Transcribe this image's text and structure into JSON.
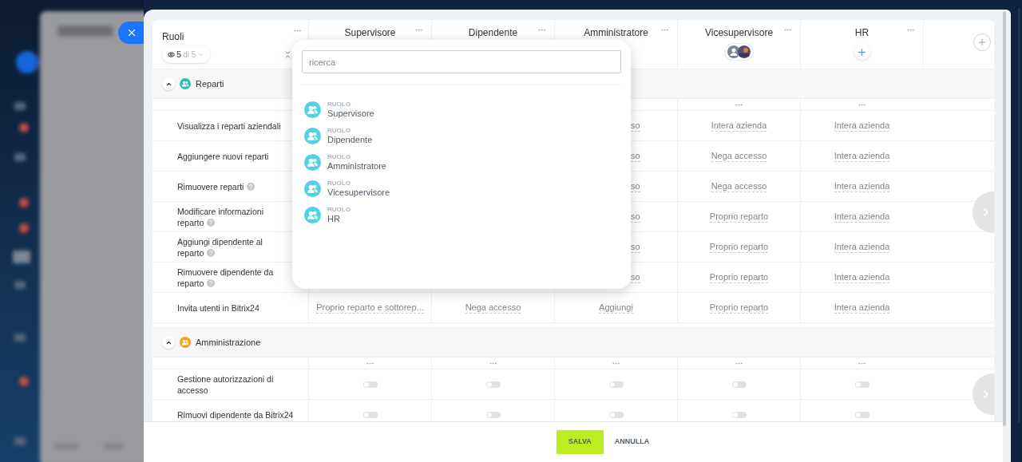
{
  "table": {
    "title": "Ruoli",
    "filter": {
      "shown": "5",
      "total": "di 5"
    },
    "columns": [
      {
        "name": "Supervisore",
        "kind": "none"
      },
      {
        "name": "Dipendente",
        "kind": "none"
      },
      {
        "name": "Amministratore",
        "kind": "none"
      },
      {
        "name": "Vicesupervisore",
        "kind": "avatars"
      },
      {
        "name": "HR",
        "kind": "add"
      }
    ],
    "sections": [
      {
        "title": "Reparti",
        "color": "#2bbfae",
        "expanded": true,
        "dots": [
          false,
          false,
          false,
          true,
          true
        ],
        "rows": [
          {
            "label": "Visualizza i reparti aziendali",
            "help": false,
            "kind": "select",
            "cells": [
              null,
              null,
              {
                "text": "so",
                "clipped": true
              },
              {
                "text": "Intera azienda",
                "clipped": false
              },
              {
                "text": "Intera azienda",
                "clipped": false
              }
            ]
          },
          {
            "label": "Aggiungere nuovi reparti",
            "help": false,
            "kind": "select",
            "cells": [
              null,
              null,
              {
                "text": "so",
                "clipped": true
              },
              {
                "text": "Nega accesso",
                "clipped": false
              },
              {
                "text": "Intera azienda",
                "clipped": false
              }
            ]
          },
          {
            "label": "Rimuovere reparti",
            "help": true,
            "kind": "select",
            "cells": [
              null,
              null,
              {
                "text": "so",
                "clipped": true
              },
              {
                "text": "Nega accesso",
                "clipped": false
              },
              {
                "text": "Intera azienda",
                "clipped": false
              }
            ]
          },
          {
            "label": "Modificare informazioni reparto",
            "help": true,
            "kind": "select",
            "cells": [
              null,
              null,
              {
                "text": "so",
                "clipped": true
              },
              {
                "text": "Proprio reparto",
                "clipped": false
              },
              {
                "text": "Intera azienda",
                "clipped": false
              }
            ]
          },
          {
            "label": "Aggiungi dipendente al reparto",
            "help": true,
            "kind": "select",
            "cells": [
              null,
              null,
              {
                "text": "so",
                "clipped": true
              },
              {
                "text": "Proprio reparto",
                "clipped": false
              },
              {
                "text": "Intera azienda",
                "clipped": false
              }
            ]
          },
          {
            "label": "Rimuovere dipendente da reparto",
            "help": true,
            "kind": "select",
            "cells": [
              null,
              null,
              {
                "text": "so",
                "clipped": true
              },
              {
                "text": "Proprio reparto",
                "clipped": false
              },
              {
                "text": "Intera azienda",
                "clipped": false
              }
            ]
          },
          {
            "label": "Invita utenti in Bitrix24",
            "help": false,
            "kind": "select",
            "cells": [
              {
                "text": "Proprio reparto e sottorep...",
                "clipped": false
              },
              {
                "text": "Nega accesso",
                "clipped": false
              },
              {
                "text": "Aggiungi",
                "clipped": false
              },
              {
                "text": "Proprio reparto",
                "clipped": false
              },
              {
                "text": "Intera azienda",
                "clipped": false
              }
            ]
          }
        ]
      },
      {
        "title": "Amministrazione",
        "color": "#f5a216",
        "expanded": true,
        "dots": [
          true,
          true,
          true,
          true,
          true
        ],
        "rows": [
          {
            "label": "Gestione autorizzazioni di accesso",
            "help": false,
            "kind": "toggle",
            "cells": [
              {
                "on": false
              },
              {
                "on": false
              },
              {
                "on": false
              },
              {
                "on": false
              },
              {
                "on": false
              }
            ]
          },
          {
            "label": "Rimuovi dipendente da Bitrix24",
            "help": false,
            "kind": "toggle",
            "cells": [
              {
                "on": false
              },
              {
                "on": false
              },
              {
                "on": false
              },
              {
                "on": false
              },
              {
                "on": false
              }
            ]
          }
        ]
      }
    ]
  },
  "popup": {
    "search": {
      "placeholder": "ricerca"
    },
    "items": [
      {
        "type": "RUOLO",
        "name": "Supervisore"
      },
      {
        "type": "RUOLO",
        "name": "Dipendente"
      },
      {
        "type": "RUOLO",
        "name": "Amministratore"
      },
      {
        "type": "RUOLO",
        "name": "Vicesupervisore"
      },
      {
        "type": "RUOLO",
        "name": "HR"
      }
    ]
  },
  "footer": {
    "buttons": [
      {
        "label": "SALVA",
        "kind": "primary"
      },
      {
        "label": "ANNULLA",
        "kind": "link"
      }
    ]
  }
}
